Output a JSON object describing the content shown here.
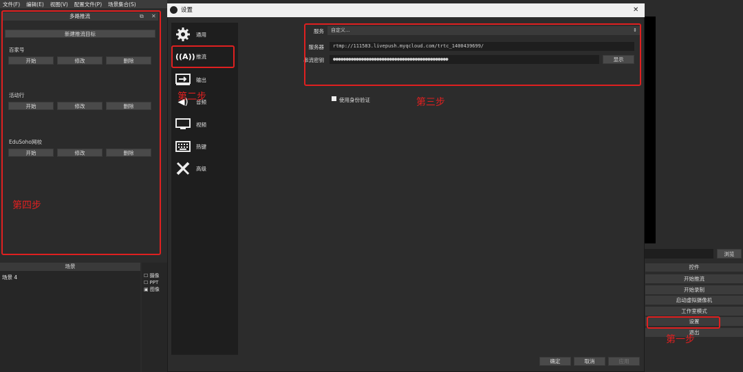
{
  "menu": [
    "文件(F)",
    "编辑(E)",
    "视图(V)",
    "配置文件(P)",
    "场景集合(S)"
  ],
  "multistream": {
    "title": "多路推流",
    "new_target": "新建推流目标",
    "targets": [
      {
        "name": "百家号",
        "start": "开始",
        "edit": "修改",
        "delete": "删除"
      },
      {
        "name": "活动行",
        "start": "开始",
        "edit": "修改",
        "delete": "删除"
      },
      {
        "name": "EduSoho网校",
        "start": "开始",
        "edit": "修改",
        "delete": "删除"
      }
    ],
    "step_label": "第四步"
  },
  "scenes": {
    "title": "场景",
    "items": [
      "场景 4"
    ]
  },
  "sources": {
    "items": [
      "摄像",
      "PPT",
      "图像"
    ]
  },
  "settings": {
    "title": "设置",
    "nav": [
      {
        "label": "通用"
      },
      {
        "label": "推流"
      },
      {
        "label": "输出"
      },
      {
        "label": "音频"
      },
      {
        "label": "视频"
      },
      {
        "label": "热键"
      },
      {
        "label": "高级"
      }
    ],
    "step2_label": "第二步",
    "service_label": "服务",
    "service_value": "自定义...",
    "server_label": "服务器",
    "server_value": "rtmp://111583.livepush.myqcloud.com/trtc_1400439699/",
    "key_label": "串流密钥",
    "key_value": "●●●●●●●●●●●●●●●●●●●●●●●●●●●●●●●●●●●●●●●●●●●●●",
    "show_button": "显示",
    "auth_label": "使用身份验证",
    "step3_label": "第三步",
    "ok": "确定",
    "cancel": "取消",
    "apply": "应用"
  },
  "controls": {
    "browse": "浏览",
    "title": "控件",
    "buttons": [
      "开始推流",
      "开始录制",
      "启动虚拟摄像机",
      "工作室模式",
      "设置",
      "退出"
    ],
    "step1_label": "第一步"
  },
  "colors": {
    "highlight": "#e02020",
    "accent": "#2a82da"
  }
}
